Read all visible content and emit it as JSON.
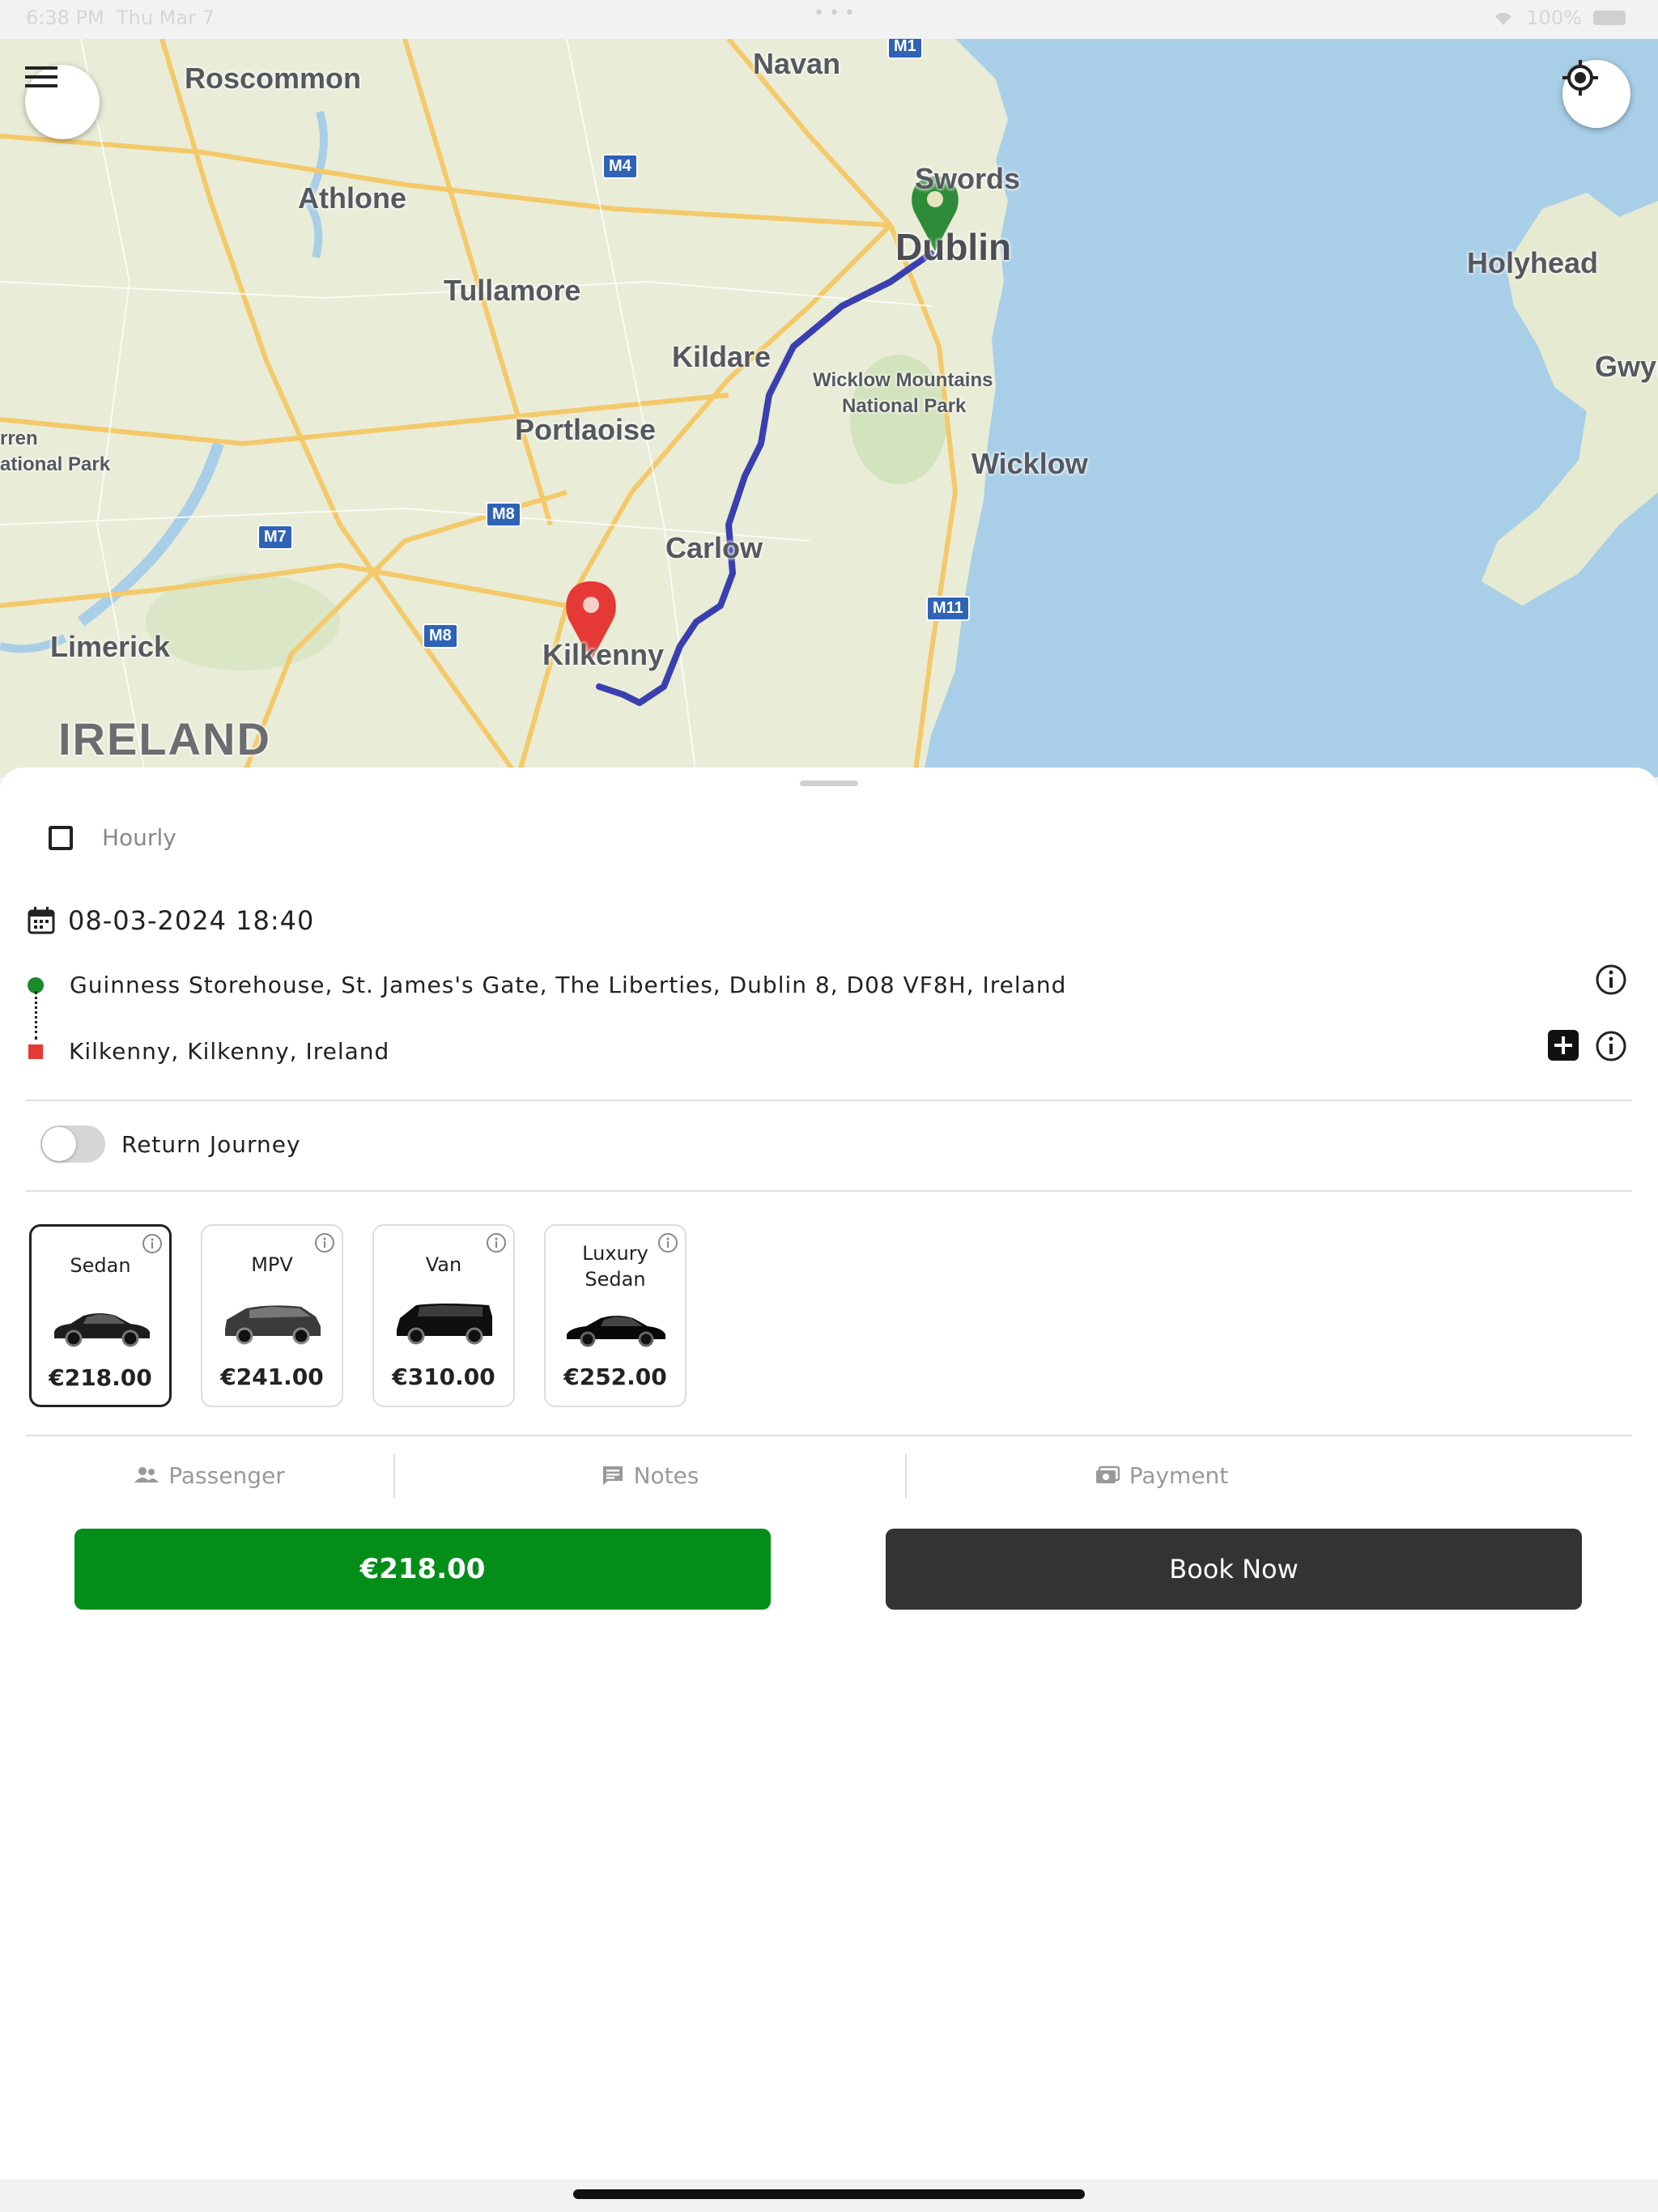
{
  "status_bar": {
    "time": "6:38 PM",
    "date": "Thu Mar 7",
    "battery": "100%"
  },
  "map": {
    "labels": {
      "roscommon": "Roscommon",
      "navan": "Navan",
      "athlone": "Athlone",
      "swords": "Swords",
      "dublin": "Dublin",
      "holyhead": "Holyhead",
      "tullamore": "Tullamore",
      "kildare": "Kildare",
      "wicklow_mountains": "Wicklow Mountains",
      "national_park": "National Park",
      "gwynedd": "Gwyn",
      "portlaoise": "Portlaoise",
      "wicklow": "Wicklow",
      "carlow": "Carlow",
      "kilkenny": "Kilkenny",
      "limerick": "Limerick",
      "ireland": "IRELAND",
      "burren": "rren",
      "ational_park": "ational Park"
    },
    "shields": {
      "m1": "M1",
      "m4": "M4",
      "m7": "M7",
      "m8a": "M8",
      "m8b": "M8",
      "m11": "M11"
    }
  },
  "booking": {
    "hourly_label": "Hourly",
    "datetime": "08-03-2024 18:40",
    "pickup": "Guinness Storehouse, St. James's Gate, The Liberties, Dublin 8, D08 VF8H, Ireland",
    "dropoff": "Kilkenny, Kilkenny, Ireland",
    "return_journey_label": "Return Journey",
    "return_journey_on": false
  },
  "vehicles": [
    {
      "name": "Sedan",
      "price": "€218.00",
      "selected": true
    },
    {
      "name": "MPV",
      "price": "€241.00",
      "selected": false
    },
    {
      "name": "Van",
      "price": "€310.00",
      "selected": false
    },
    {
      "name": "Luxury Sedan",
      "name_line1": "Luxury",
      "name_line2": "Sedan",
      "price": "€252.00",
      "selected": false
    }
  ],
  "tabs": {
    "passenger": "Passenger",
    "notes": "Notes",
    "payment": "Payment"
  },
  "actions": {
    "price_button": "€218.00",
    "book_button": "Book Now"
  },
  "colors": {
    "price_button": "#038e1a",
    "book_button": "#333333",
    "route_line": "#3a3fb0",
    "pickup_pin": "#2e8b3a",
    "dropoff_pin": "#e53935"
  }
}
